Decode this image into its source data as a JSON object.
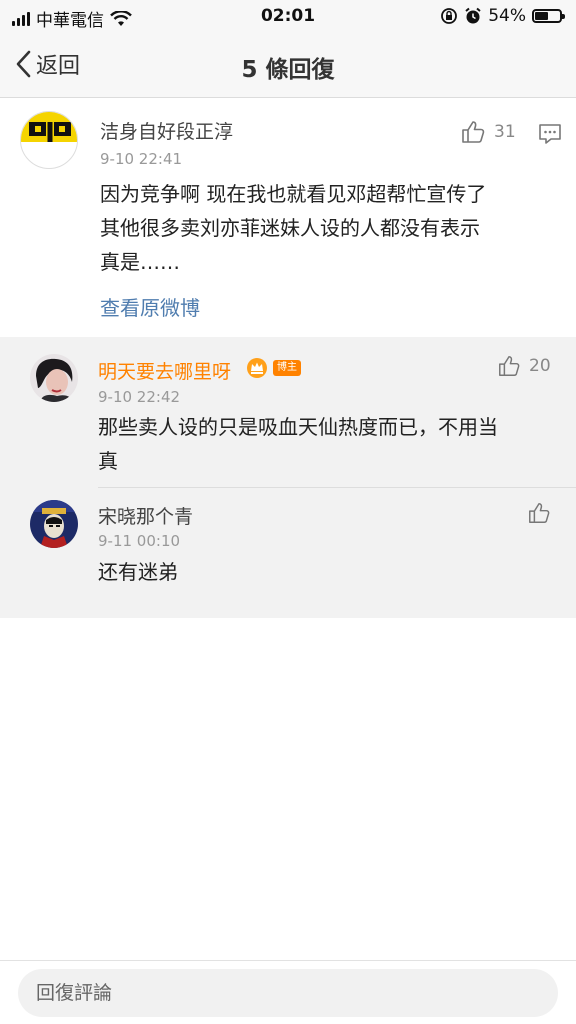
{
  "status_bar": {
    "carrier": "中華電信",
    "time": "02:01",
    "battery": "54%",
    "battery_level": 0.54
  },
  "nav": {
    "back_label": "返回",
    "title": "5 條回復"
  },
  "main_comment": {
    "username": "洁身自好段正淳",
    "timestamp": "9-10 22:41",
    "likes": "31",
    "content_line1": "因为竞争啊 现在我也就看见邓超帮忙宣传了",
    "content_line2": "其他很多卖刘亦菲迷妹人设的人都没有表示",
    "content_line3": "真是……",
    "view_original": "查看原微博"
  },
  "replies": [
    {
      "username": "明天要去哪里呀",
      "badge": "博主",
      "timestamp": "9-10 22:42",
      "likes": "20",
      "content_line1": "那些卖人设的只是吸血天仙热度而已，不用当",
      "content_line2": "真"
    },
    {
      "username": "宋晓那个青",
      "timestamp": "9-11 00:10",
      "likes": "",
      "content_line1": "还有迷弟"
    }
  ],
  "bottom_bar": {
    "placeholder": "回復評論"
  },
  "colors": {
    "accent_link": "#507daf",
    "blogger_name": "#ff8200",
    "avatar_yellow": "#f5d400"
  }
}
